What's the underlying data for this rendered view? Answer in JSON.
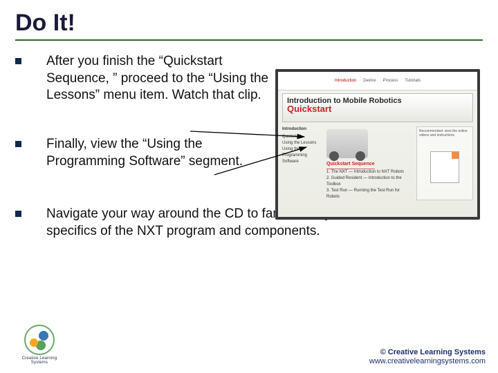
{
  "title": "Do It!",
  "bullets": [
    "After you finish the “Quickstart Sequence, ” proceed to the “Using the Lessons” menu item. Watch that clip.",
    "Finally, view the “Using the Programming Software” segment.",
    "Navigate your way around the CD to familiarize yourself with the specifics of the NXT program and components."
  ],
  "screenshot": {
    "tabs": [
      "Introduction",
      "Device",
      "Process",
      "Tutorials"
    ],
    "banner_line1": "Introduction to Mobile Robotics",
    "banner_line2": "Quickstart",
    "sidebar": {
      "heading": "Introduction",
      "items": [
        "Quickstart",
        "Using the Lessons",
        "Using the Programming Software"
      ]
    },
    "main_heading": "Quickstart Sequence",
    "steps": [
      "1. The NXT — Introduction to NXT Robots",
      "2. Guided Resident — Introduction to the Toolbox",
      "3. Test Run — Running the Test Run for Robots"
    ],
    "right_note": "Recommended: view the online videos and instructions"
  },
  "footer": {
    "copyright": "© Creative Learning Systems",
    "url": "www.creativelearningsystems.com"
  },
  "logo_text": "Creative Learning Systems"
}
